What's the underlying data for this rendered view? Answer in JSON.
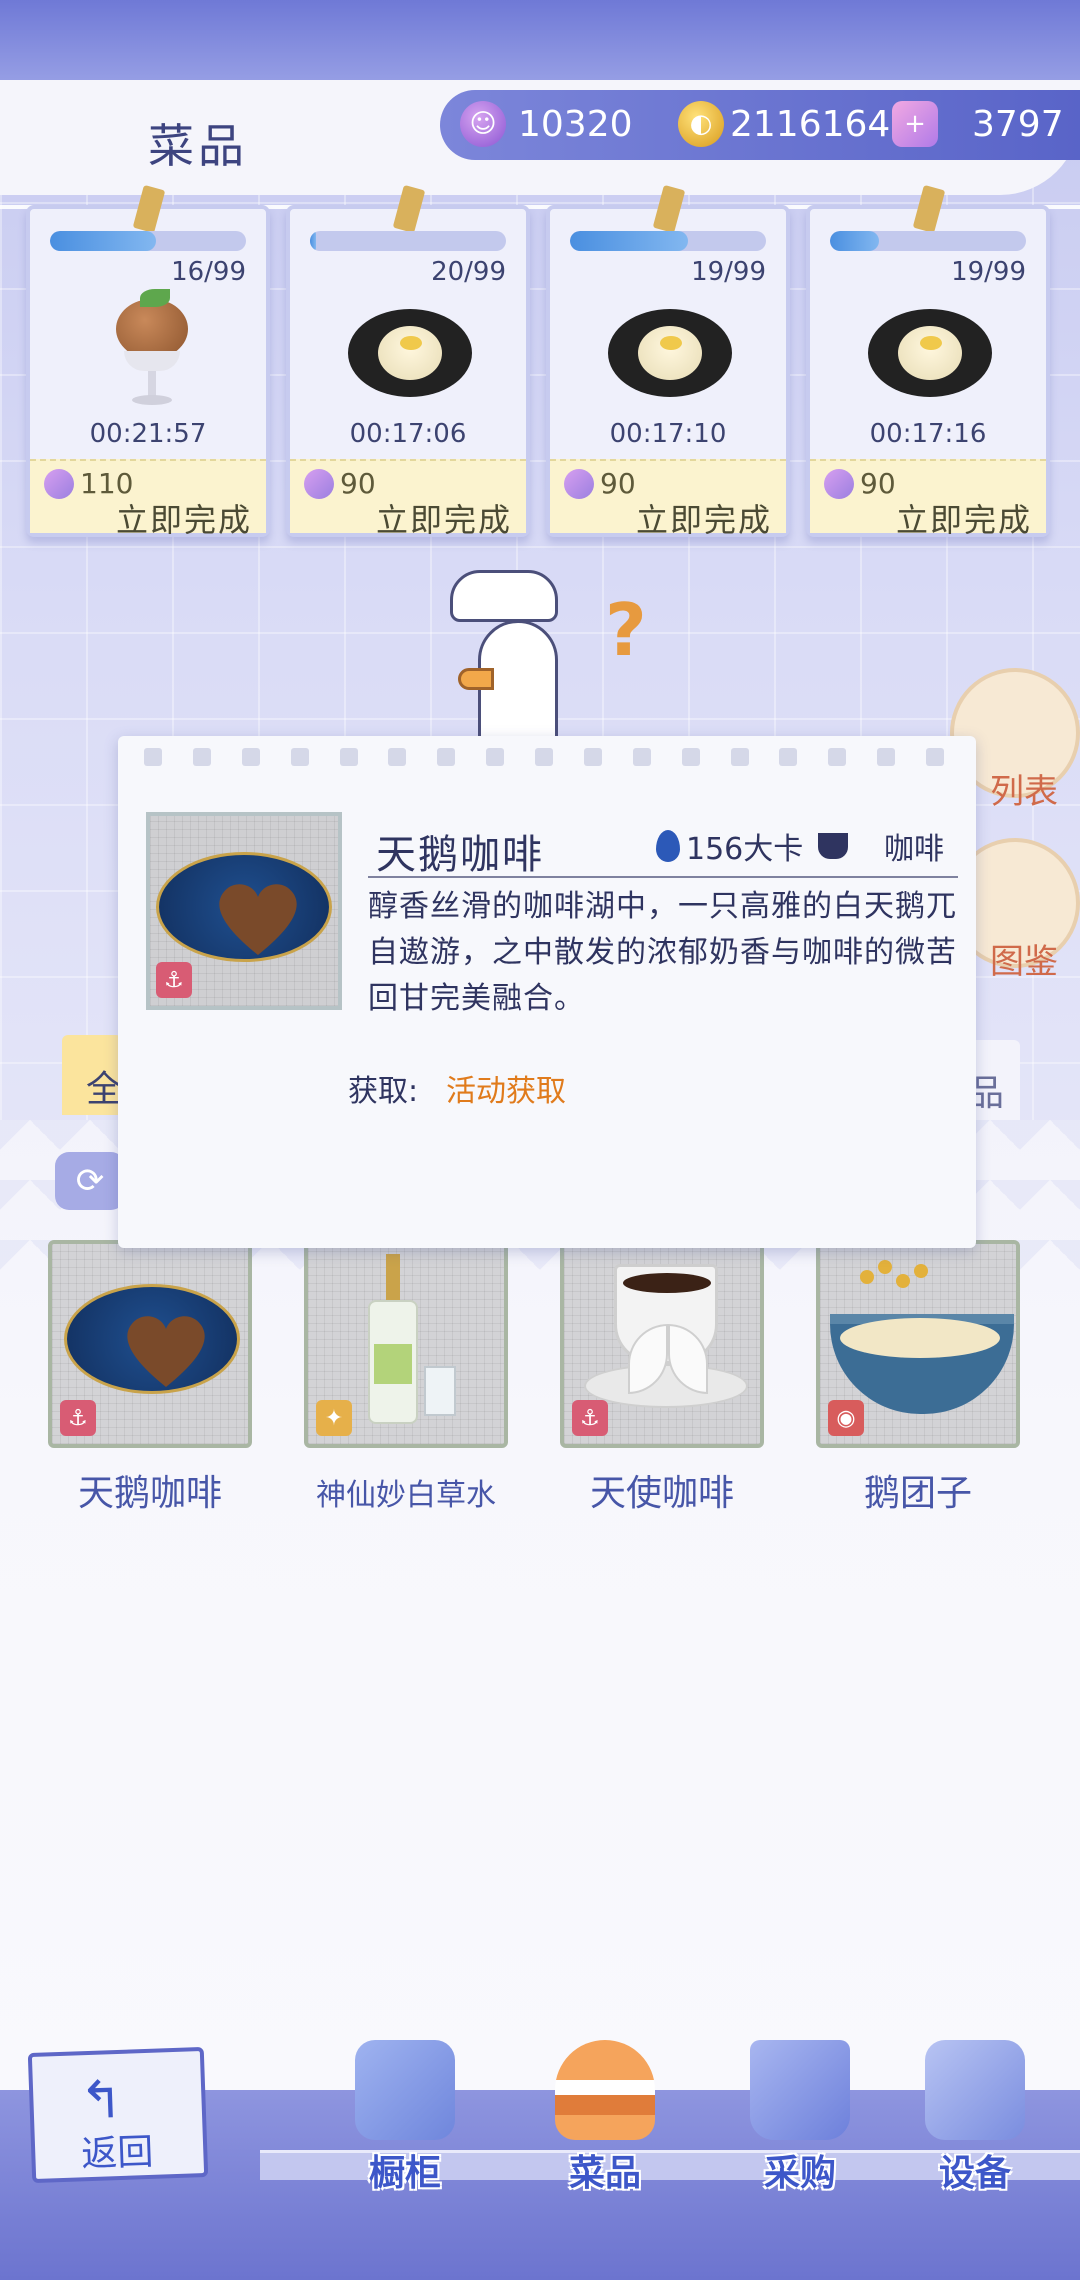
{
  "header": {
    "title": "菜品",
    "currencies": [
      {
        "icon": "purple-gem-icon",
        "value": "10320"
      },
      {
        "icon": "gold-coin-icon",
        "value": "2116164"
      },
      {
        "icon": "swan-plus-icon",
        "value": "3797"
      }
    ]
  },
  "cooking_queue": [
    {
      "count": "16/99",
      "progress": 0.54,
      "timer": "00:21:57",
      "cost": "110",
      "action": "立即完成",
      "dish_icon": "sundae-icon"
    },
    {
      "count": "20/99",
      "progress": 0.03,
      "timer": "00:17:06",
      "cost": "90",
      "action": "立即完成",
      "dish_icon": "bun-plate-icon"
    },
    {
      "count": "19/99",
      "progress": 0.6,
      "timer": "00:17:10",
      "cost": "90",
      "action": "立即完成",
      "dish_icon": "bun-plate-icon"
    },
    {
      "count": "19/99",
      "progress": 0.25,
      "timer": "00:17:16",
      "cost": "90",
      "action": "立即完成",
      "dish_icon": "bun-plate-icon"
    }
  ],
  "side_buttons": {
    "list_label": "列表",
    "guide_label": "图鉴"
  },
  "tabs": {
    "left_label": "全",
    "right_label": "品"
  },
  "popup": {
    "title": "天鹅咖啡",
    "calories": "156大卡",
    "type": "咖啡",
    "description": "醇香丝滑的咖啡湖中，一只高雅的白天鹅兀自遨游，之中散发的浓郁奶香与咖啡的微苦回甘完美融合。",
    "get_label": "获取:",
    "get_value": "活动获取"
  },
  "dishes": [
    {
      "name": "天鹅咖啡",
      "badge": "anchor-icon"
    },
    {
      "name": "神仙妙白草水",
      "badge": "puzzle-icon"
    },
    {
      "name": "天使咖啡",
      "badge": "anchor-icon"
    },
    {
      "name": "鹅团子",
      "badge": "lantern-icon"
    }
  ],
  "nav": {
    "back": "返回",
    "items": [
      {
        "label": "橱柜",
        "icon": "cabinet-icon"
      },
      {
        "label": "菜品",
        "icon": "burger-icon"
      },
      {
        "label": "采购",
        "icon": "shopping-bag-icon"
      },
      {
        "label": "设备",
        "icon": "coffee-machine-icon"
      }
    ]
  },
  "colors": {
    "accent": "#5964c8",
    "finish_bg": "#fbf3cf",
    "get_source": "#e07b1c"
  }
}
